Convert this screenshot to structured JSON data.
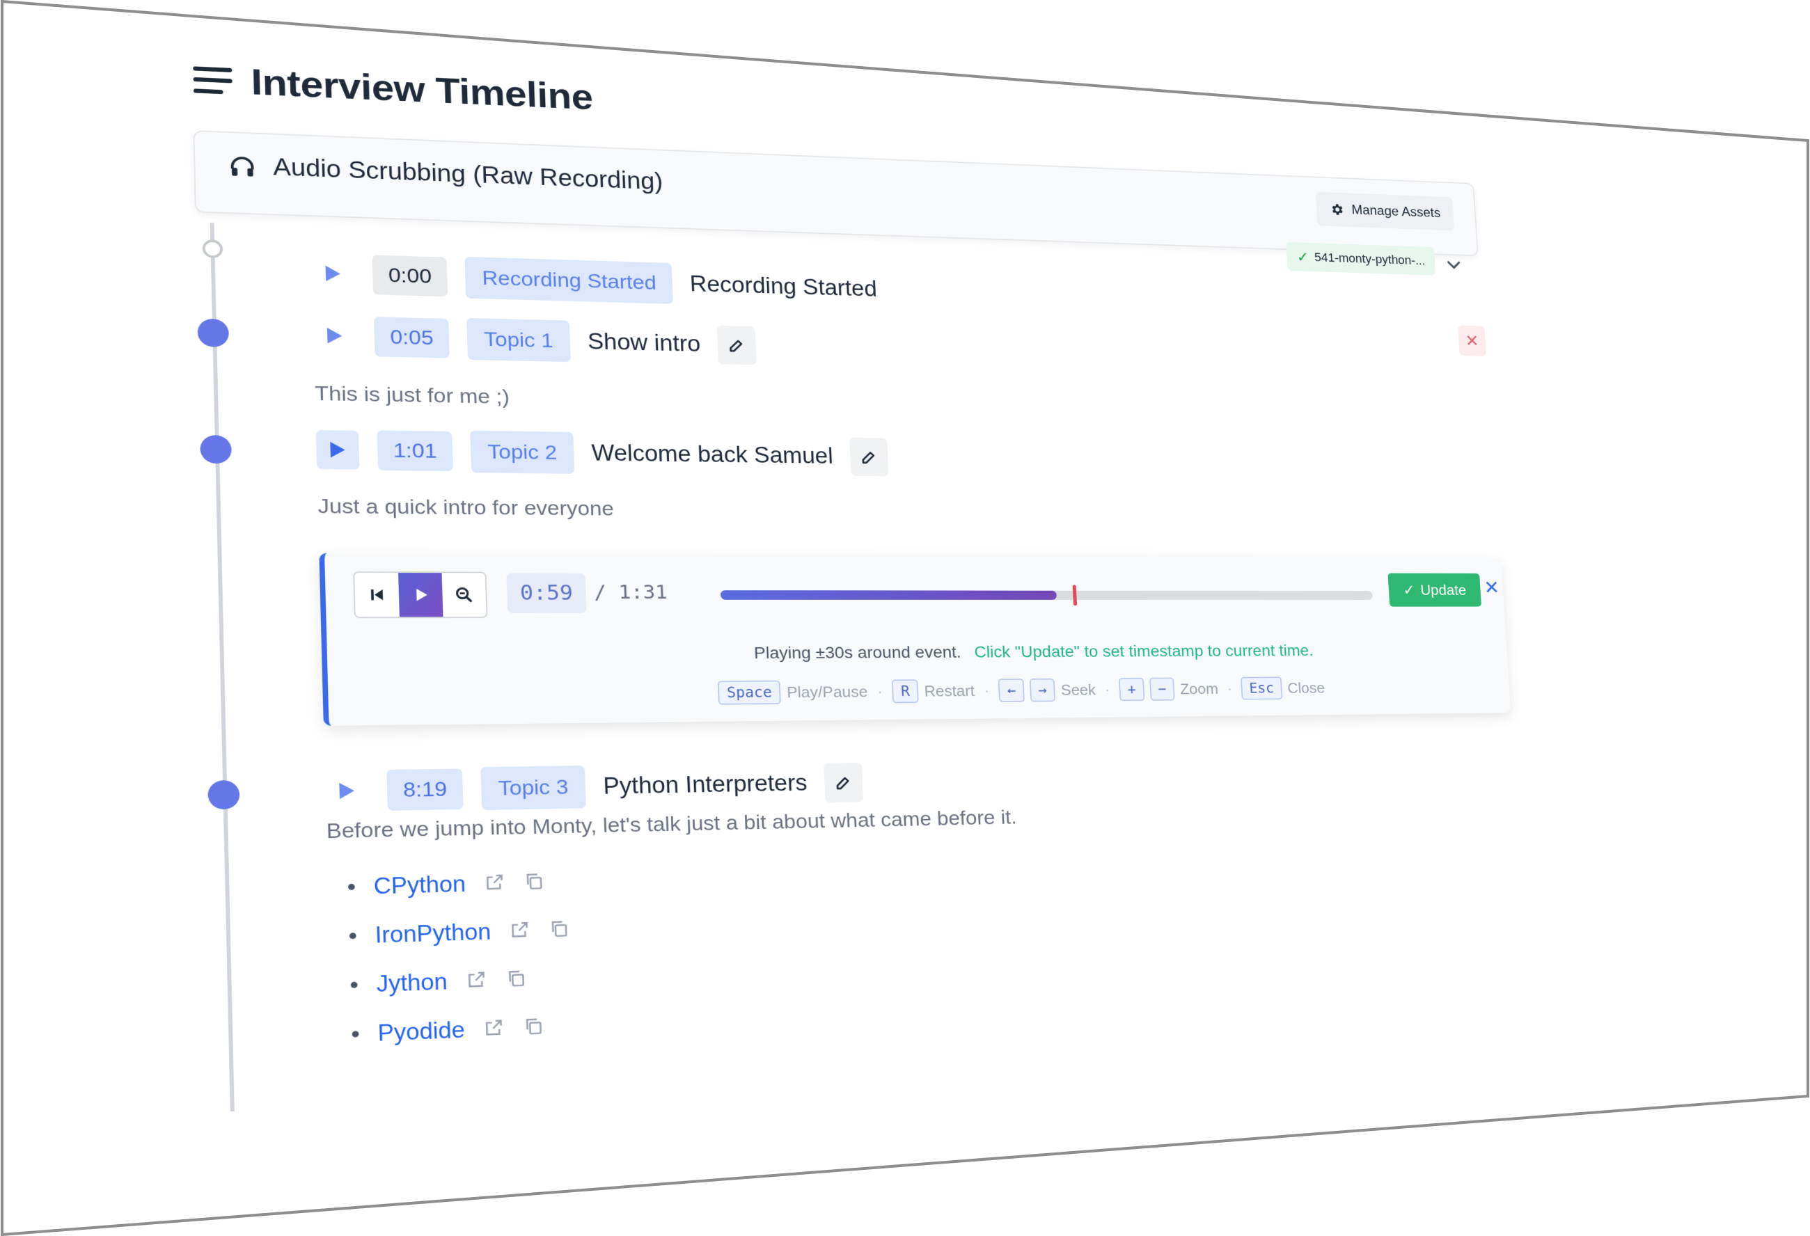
{
  "header": {
    "title": "Interview Timeline"
  },
  "audio": {
    "title": "Audio Scrubbing (Raw Recording)",
    "manage_label": "Manage Assets",
    "file_chip": "541-monty-python-..."
  },
  "events": [
    {
      "time": "0:00",
      "tag": "Recording Started",
      "title": "Recording Started",
      "note": ""
    },
    {
      "time": "0:05",
      "tag": "Topic 1",
      "title": "Show intro",
      "note": "This is just for me ;)"
    },
    {
      "time": "1:01",
      "tag": "Topic 2",
      "title": "Welcome back Samuel",
      "note": "Just a quick intro for everyone"
    },
    {
      "time": "8:19",
      "tag": "Topic 3",
      "title": "Python Interpreters",
      "note": "Before we jump into Monty, let's talk just a bit about what came before it."
    }
  ],
  "player": {
    "current_time": "0:59",
    "duration": "/ 1:31",
    "progress": 0.5,
    "marker": 0.525,
    "update_label": "Update",
    "hint": "Playing ±30s around event.",
    "hint_action": "Click \"Update\" to set timestamp to current time.",
    "shortcuts": [
      {
        "keys": [
          "Space"
        ],
        "label": "Play/Pause"
      },
      {
        "keys": [
          "R"
        ],
        "label": "Restart"
      },
      {
        "keys": [
          "←",
          "→"
        ],
        "label": "Seek"
      },
      {
        "keys": [
          "+",
          "−"
        ],
        "label": "Zoom"
      },
      {
        "keys": [
          "Esc"
        ],
        "label": "Close"
      }
    ]
  },
  "links": [
    "CPython",
    "IronPython",
    "Jython",
    "Pyodide"
  ],
  "colors": {
    "accent": "#3b6ae8",
    "node": "#6576e6",
    "update": "#2eb872",
    "marker": "#e04a5a"
  }
}
